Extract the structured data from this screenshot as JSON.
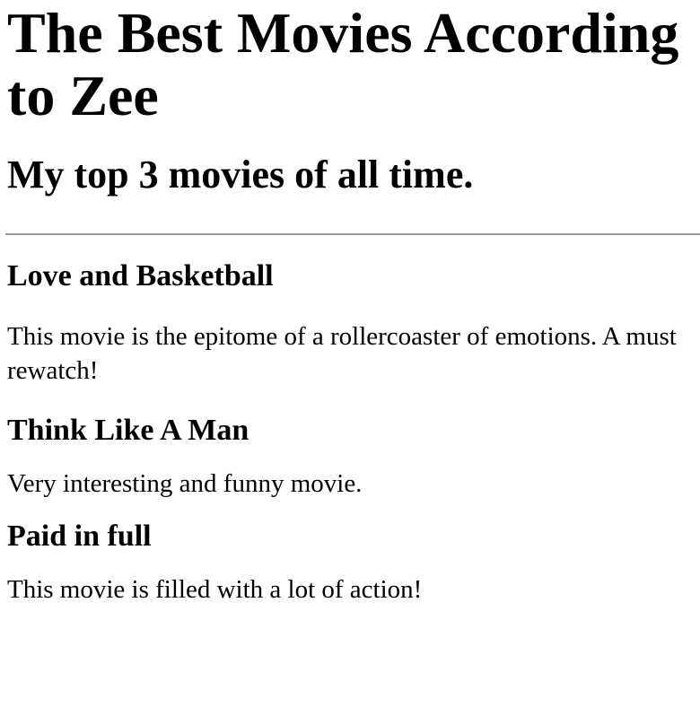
{
  "page": {
    "title": "The Best Movies According to Zee",
    "subtitle": "My top 3 movies of all time."
  },
  "movies": [
    {
      "title": "Love and Basketball",
      "description": "This movie is the epitome of a rollercoaster of emotions. A must rewatch!"
    },
    {
      "title": "Think Like A Man",
      "description": "Very interesting and funny movie."
    },
    {
      "title": "Paid in full",
      "description": "This movie is filled with a lot of action!"
    }
  ]
}
